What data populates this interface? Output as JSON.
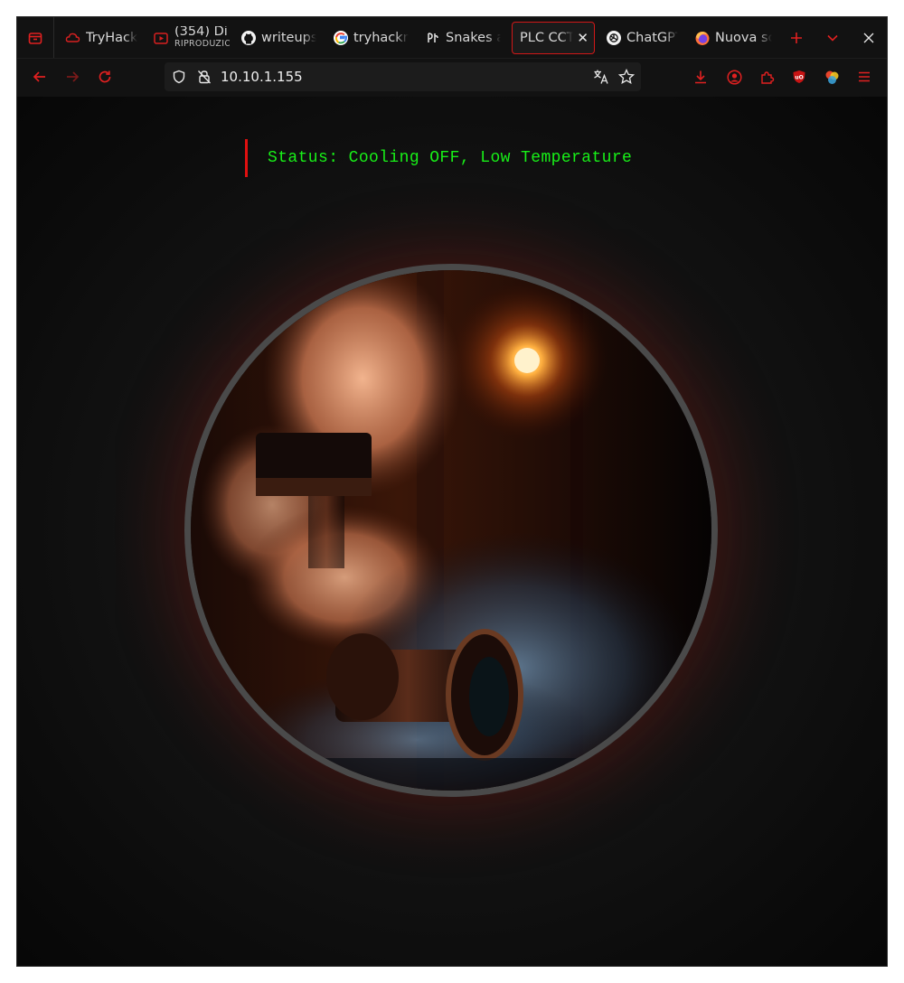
{
  "browser": {
    "tabs": [
      {
        "label": "TryHackMe",
        "icon": "thm-cloud-icon",
        "active": false
      },
      {
        "label": "(354) Di",
        "sublabel": "RIPRODUZIONE",
        "icon": "youtube-icon",
        "active": false,
        "playing": true
      },
      {
        "label": "writeups",
        "icon": "github-icon",
        "active": false
      },
      {
        "label": "tryhackme",
        "icon": "google-icon",
        "active": false
      },
      {
        "label": "Snakes and",
        "icon": "snakes-icon",
        "active": false
      },
      {
        "label": "PLC CCTV",
        "icon": "",
        "active": true
      },
      {
        "label": "ChatGPT",
        "icon": "chatgpt-icon",
        "active": false
      },
      {
        "label": "Nuova scheda",
        "icon": "firefox-icon",
        "active": false
      }
    ],
    "url": "10.10.1.155",
    "accent_color": "#e02020"
  },
  "page": {
    "status_text": "Status: Cooling OFF, Low Temperature",
    "status_color": "#18f018",
    "status_bar_color": "#e01010"
  }
}
